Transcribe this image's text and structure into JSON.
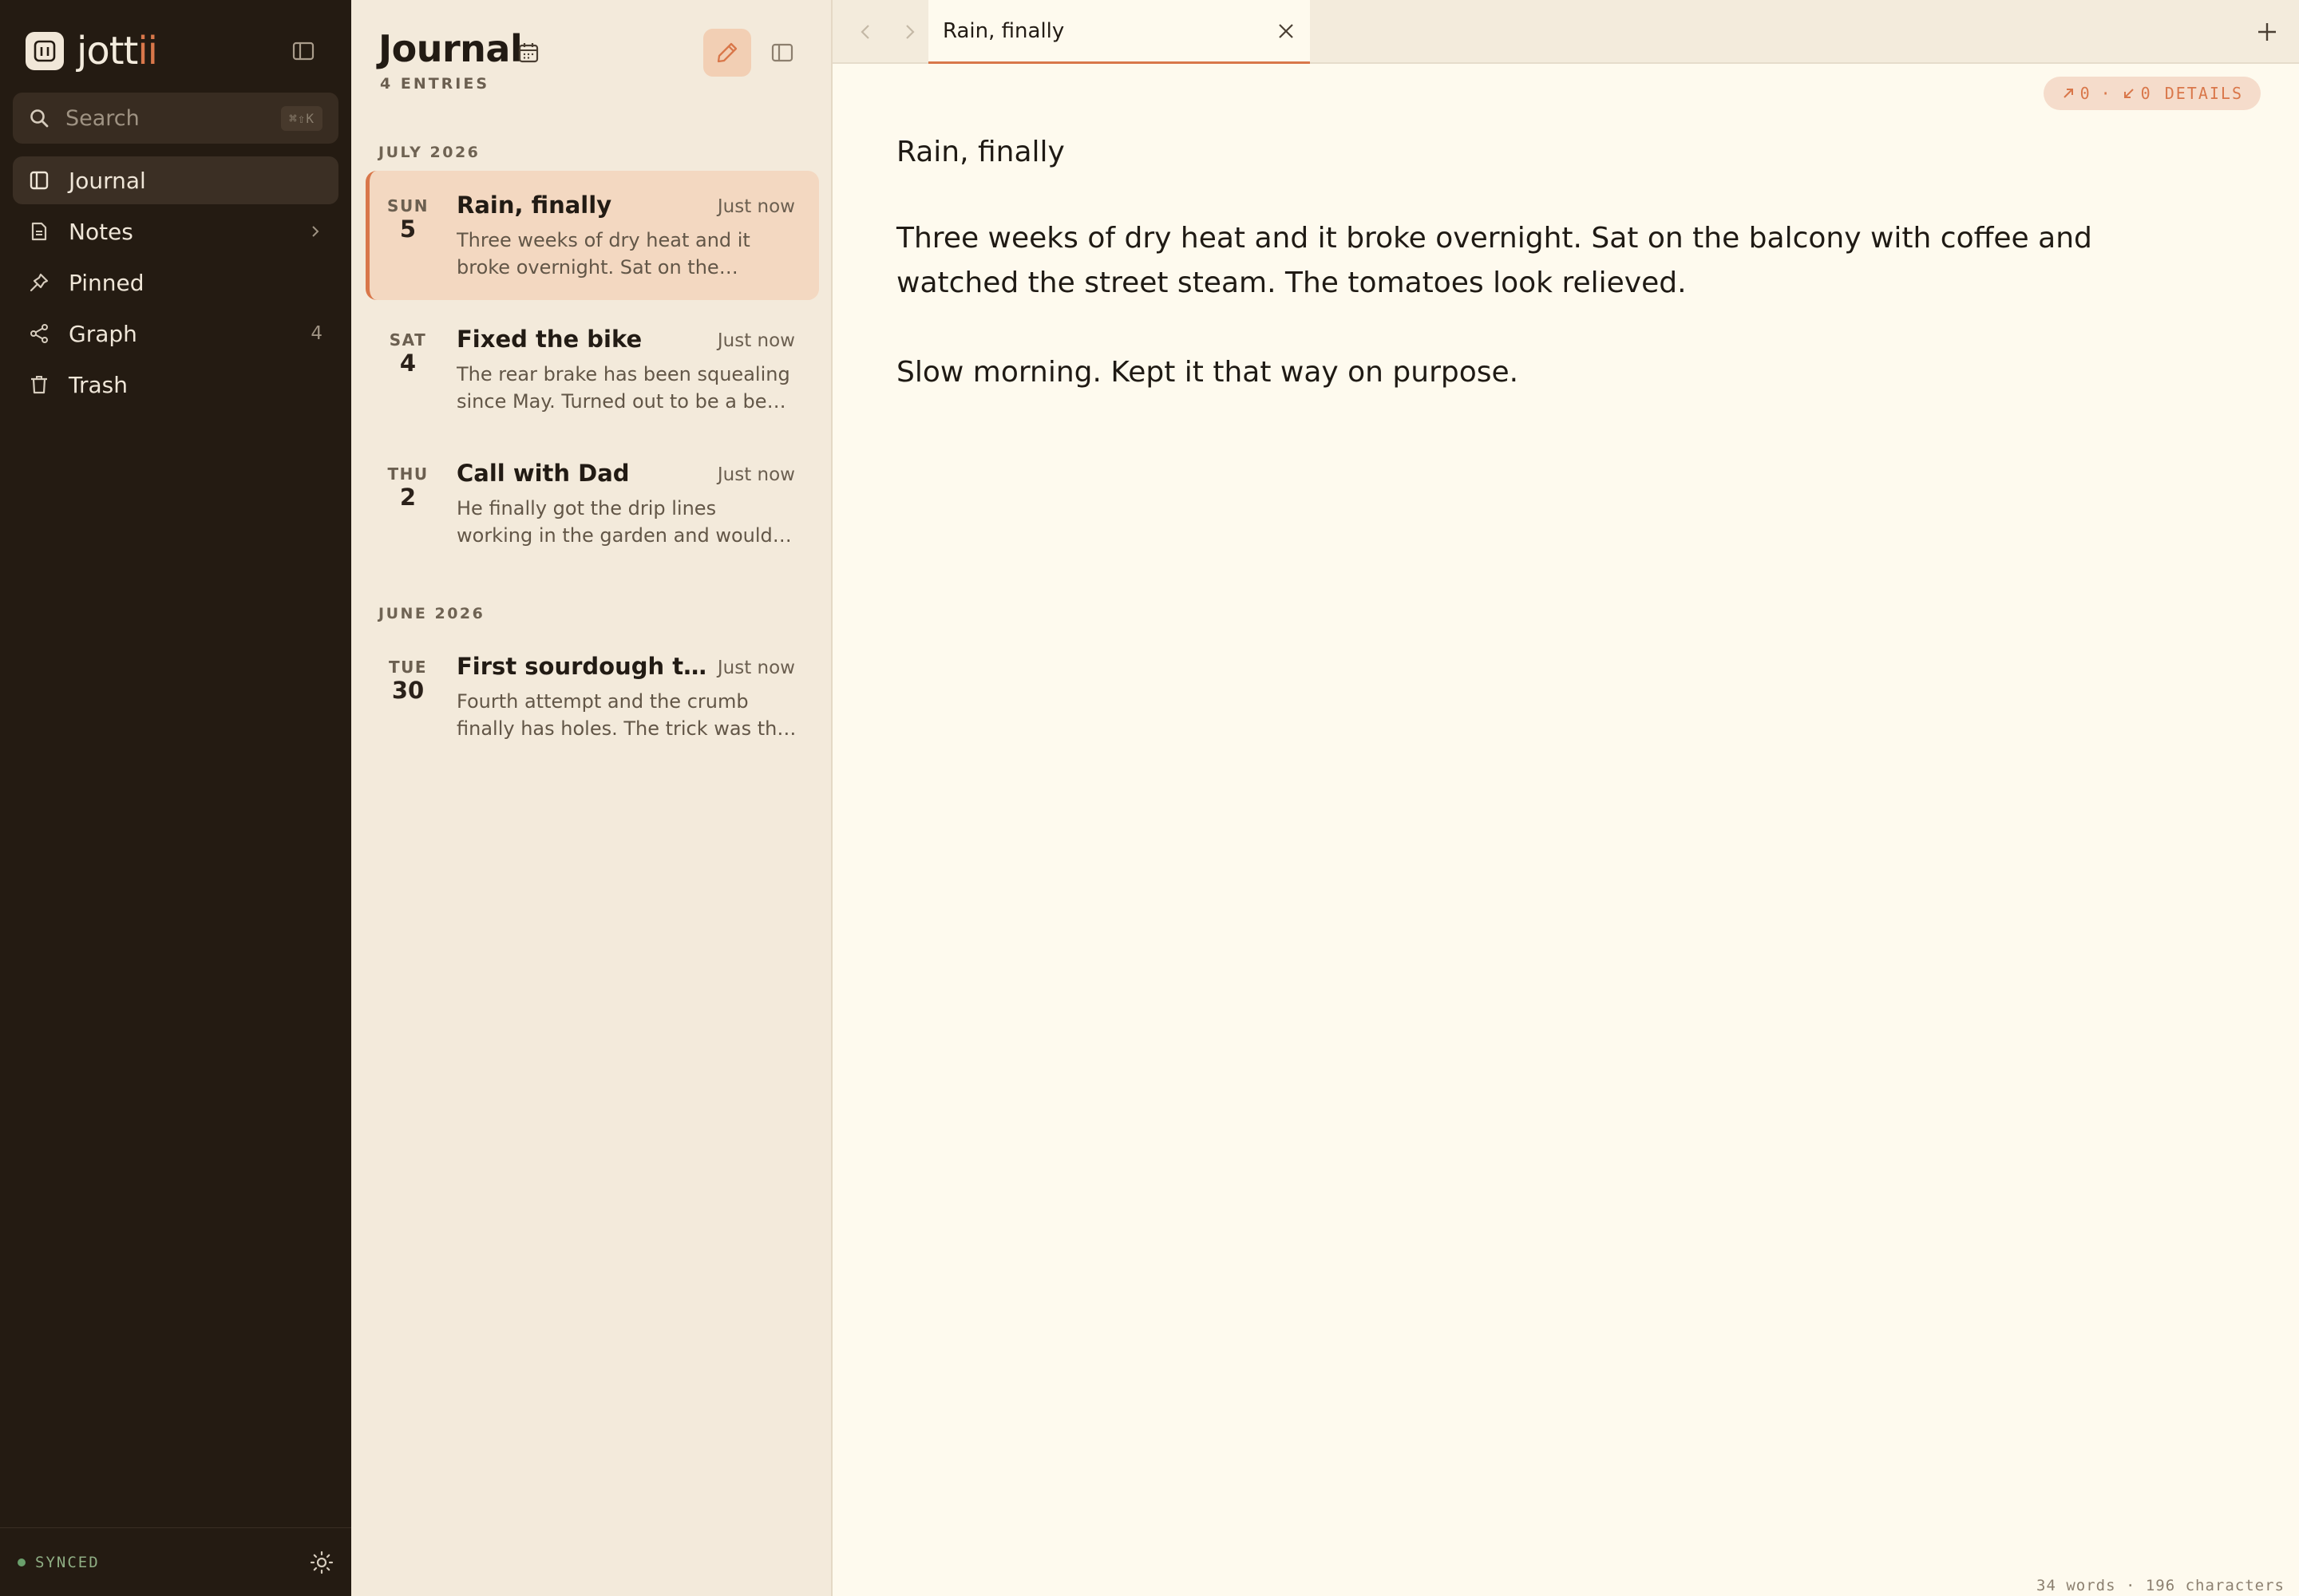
{
  "app": {
    "name_main": "jott",
    "name_accent": "ii"
  },
  "sidebar": {
    "search_label": "Search",
    "search_shortcut": "⌘⇧K",
    "items": [
      {
        "label": "Journal",
        "icon": "book-icon",
        "active": true
      },
      {
        "label": "Notes",
        "icon": "document-icon",
        "chevron": true
      },
      {
        "label": "Pinned",
        "icon": "pin-icon"
      },
      {
        "label": "Graph",
        "icon": "share-nodes-icon",
        "count": "4"
      },
      {
        "label": "Trash",
        "icon": "trash-icon"
      }
    ],
    "sync_status": "SYNCED",
    "sync_color": "#6aa06c"
  },
  "list": {
    "title": "Journal",
    "subtitle": "4 ENTRIES",
    "groups": [
      {
        "month": "JULY 2026",
        "entries": [
          {
            "dow": "SUN",
            "day": "5",
            "title": "Rain, finally",
            "time": "Just now",
            "preview": "Three weeks of dry heat and it broke overnight. Sat on the balcony with coffee and watched the street steam."
          },
          {
            "dow": "SAT",
            "day": "4",
            "title": "Fixed the bike",
            "time": "Just now",
            "preview": "The rear brake has been squealing since May. Turned out to be a bent rotor."
          },
          {
            "dow": "THU",
            "day": "2",
            "title": "Call with Dad",
            "time": "Just now",
            "preview": "He finally got the drip lines working in the garden and would not stop talking about it."
          }
        ]
      },
      {
        "month": "JUNE 2026",
        "entries": [
          {
            "dow": "TUE",
            "day": "30",
            "title": "First sourdough that worked",
            "time": "Just now",
            "preview": "Fourth attempt and the crumb finally has holes. The trick was the longer proof."
          }
        ]
      }
    ]
  },
  "editor": {
    "tab_label": "Rain, finally",
    "backlinks_out": "0",
    "backlinks_in": "0",
    "details_label": "DETAILS",
    "doc_title": "Rain, finally",
    "paragraphs": [
      "Three weeks of dry heat and it broke overnight. Sat on the balcony with coffee and watched the street steam. The tomatoes look relieved.",
      "Slow morning. Kept it that way on purpose."
    ],
    "status": "34 words · 196 characters"
  },
  "colors": {
    "accent": "#d9774a",
    "sidebar_bg": "#241b12",
    "list_bg": "#f3eadb",
    "editor_bg": "#fefaee"
  }
}
